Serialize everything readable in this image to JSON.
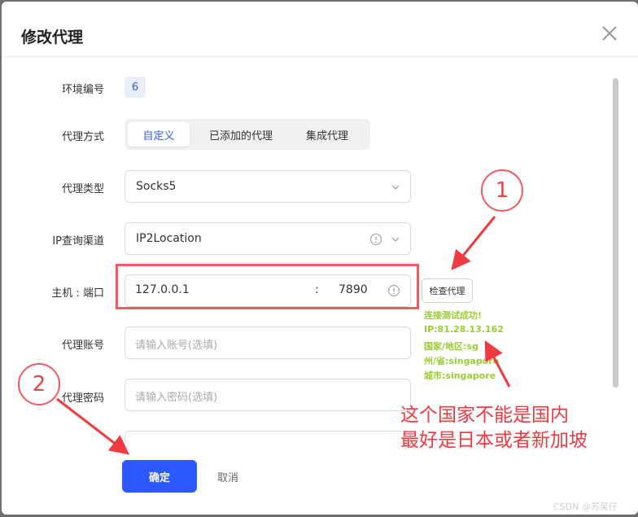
{
  "dialog": {
    "title": "修改代理",
    "close_icon": "close-icon"
  },
  "form": {
    "env_label": "环境编号",
    "env_value": "6",
    "mode_label": "代理方式",
    "mode_tabs": [
      "自定义",
      "已添加的代理",
      "集成代理"
    ],
    "mode_selected": "自定义",
    "type_label": "代理类型",
    "type_value": "Socks5",
    "ip_channel_label": "IP查询渠道",
    "ip_channel_value": "IP2Location",
    "host_label": "主机 : 端口",
    "host_value": "127.0.0.1",
    "host_separator": ":",
    "port_value": "7890",
    "check_button": "检查代理",
    "account_label": "代理账号",
    "account_placeholder": "请输入账号(选填)",
    "password_label": "代理密码",
    "password_placeholder": "请输入密码(选填)"
  },
  "check_result": {
    "line1": "连接测试成功!",
    "line2": "IP:81.28.13.162",
    "line3": "国家/地区:sg",
    "line4": "州/省:singapore",
    "line5": "城市:singapore",
    "color": "#9acd32"
  },
  "footer": {
    "confirm": "确定",
    "cancel": "取消"
  },
  "annotations": {
    "num1": "1",
    "num2": "2",
    "note_line1": "这个国家不能是国内",
    "note_line2": "最好是日本或者新加坡",
    "color": "#ef3a42"
  },
  "watermark": "CSDN @苏呆仔",
  "colors": {
    "primary": "#2b59ff",
    "highlight": "#ef5a62"
  }
}
